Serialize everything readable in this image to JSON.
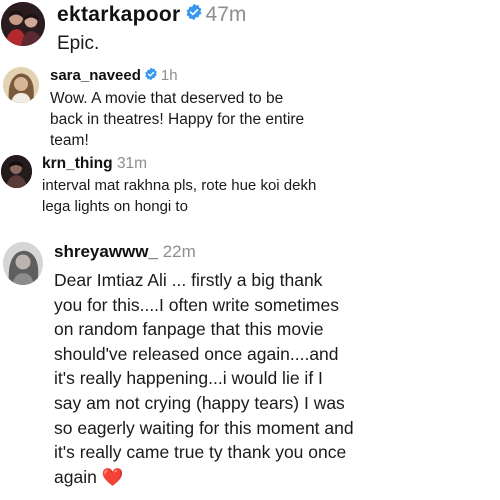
{
  "comments": [
    {
      "username": "ektarkapoor",
      "verified": true,
      "time": "47m",
      "text": "Epic.",
      "avatar_icon": "user-avatar"
    },
    {
      "username": "sara_naveed",
      "verified": true,
      "time": "1h",
      "text": "Wow. A movie that deserved to be back in theatres! Happy for the entire team!",
      "avatar_icon": "user-avatar"
    },
    {
      "username": "krn_thing",
      "verified": false,
      "time": "31m",
      "text": "interval mat rakhna pls, rote hue koi dekh lega lights on hongi to",
      "avatar_icon": "user-avatar"
    },
    {
      "username": "shreyawww_",
      "verified": false,
      "time": "22m",
      "text": "Dear Imtiaz Ali ... firstly a big thank you for this....I often write sometimes on random fanpage that this movie should've released once again....and it's really happening...i would lie if I say am not crying (happy tears) I was so eagerly waiting for this moment and it's really came true ty thank you once again",
      "emoji": "❤️",
      "avatar_icon": "user-avatar"
    }
  ],
  "colors": {
    "verified_badge": "#3897f0",
    "timestamp": "#8e8e8e",
    "heart": "#e0313b"
  }
}
